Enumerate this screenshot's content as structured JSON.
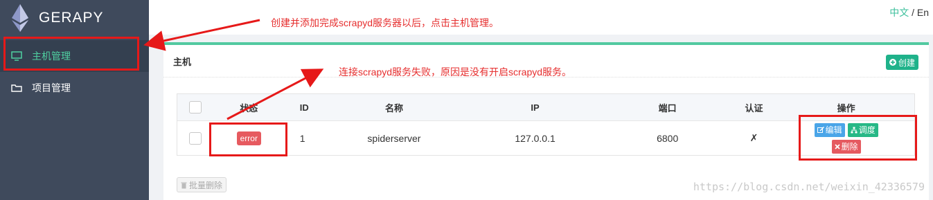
{
  "brand": {
    "name": "GERAPY"
  },
  "lang": {
    "zh": "中文",
    "sep": " / ",
    "en": "En"
  },
  "sidebar": {
    "items": [
      {
        "label": "主机管理",
        "icon": "monitor-icon",
        "active": true
      },
      {
        "label": "项目管理",
        "icon": "folder-icon",
        "active": false
      }
    ]
  },
  "panel": {
    "title": "主机",
    "create_label": "创建",
    "table": {
      "headers": [
        "状态",
        "ID",
        "名称",
        "IP",
        "端口",
        "认证",
        "操作"
      ],
      "rows": [
        {
          "status": "error",
          "id": "1",
          "name": "spiderserver",
          "ip": "127.0.0.1",
          "port": "6800",
          "auth": "✗",
          "ops": {
            "edit": "编辑",
            "schedule": "调度",
            "delete": "删除"
          }
        }
      ]
    },
    "batch_delete_label": "批量删除"
  },
  "annotations": {
    "top": "创建并添加完成scrapyd服务器以后，点击主机管理。",
    "middle": "连接scrapyd服务失败，原因是没有开启scrapyd服务。"
  },
  "watermark": "https://blog.csdn.net/weixin_42336579",
  "colors": {
    "accent": "#52c9a0",
    "sidebar": "#3f4a5c",
    "error": "#e65a5f",
    "annotation": "#e61919"
  }
}
